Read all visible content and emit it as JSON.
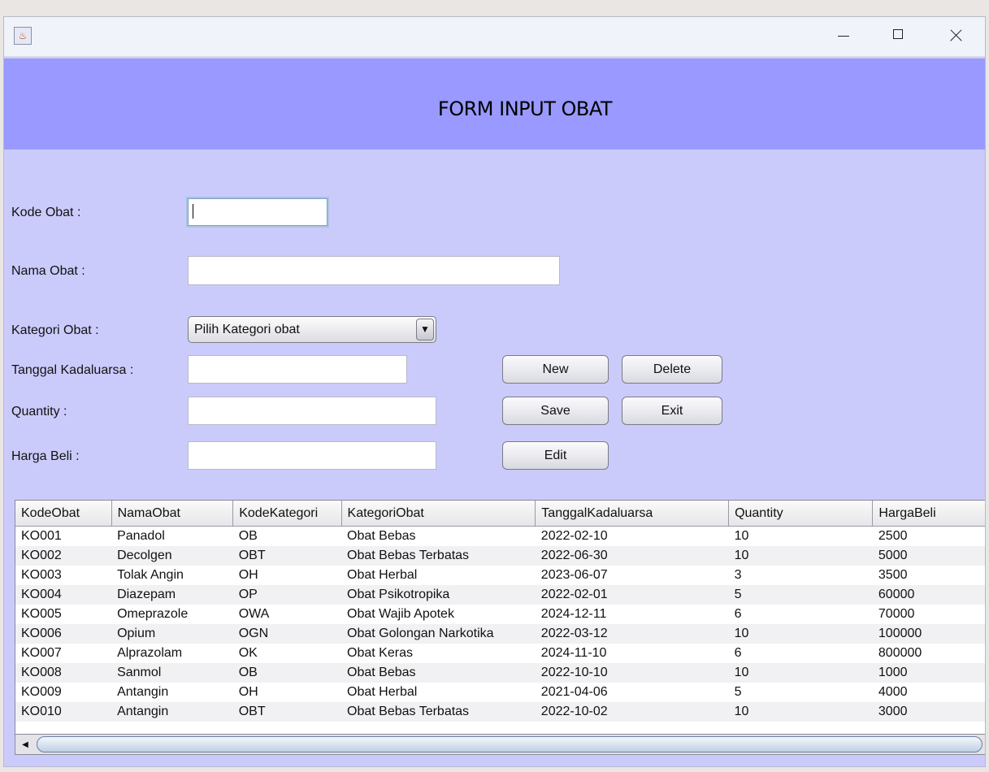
{
  "header": {
    "title": "FORM INPUT OBAT"
  },
  "icons": {
    "app": "java-cup-icon",
    "minimize": "minimize-icon",
    "maximize": "maximize-icon",
    "close": "close-icon",
    "combo_arrow": "chevron-down-icon",
    "scroll_left": "scroll-left-icon"
  },
  "form": {
    "kode_label": "Kode Obat :",
    "kode_value": "",
    "nama_label": "Nama Obat :",
    "nama_value": "",
    "kategori_label": "Kategori Obat :",
    "kategori_selected": "Pilih Kategori obat",
    "tanggal_label": "Tanggal Kadaluarsa :",
    "tanggal_value": "",
    "quantity_label": "Quantity :",
    "quantity_value": "",
    "harga_label": "Harga Beli :",
    "harga_value": ""
  },
  "buttons": {
    "new": "New",
    "delete": "Delete",
    "save": "Save",
    "exit": "Exit",
    "edit": "Edit"
  },
  "table": {
    "columns": [
      "KodeObat",
      "NamaObat",
      "KodeKategori",
      "KategoriObat",
      "TanggalKadaluarsa",
      "Quantity",
      "HargaBeli"
    ],
    "rows": [
      [
        "KO001",
        "Panadol",
        "OB",
        "Obat Bebas",
        "2022-02-10",
        "10",
        "2500"
      ],
      [
        "KO002",
        "Decolgen",
        "OBT",
        "Obat Bebas Terbatas",
        "2022-06-30",
        "10",
        "5000"
      ],
      [
        "KO003",
        "Tolak Angin",
        "OH",
        "Obat Herbal",
        "2023-06-07",
        "3",
        "3500"
      ],
      [
        "KO004",
        "Diazepam",
        "OP",
        "Obat Psikotropika",
        "2022-02-01",
        "5",
        "60000"
      ],
      [
        "KO005",
        "Omeprazole",
        "OWA",
        "Obat Wajib Apotek",
        "2024-12-11",
        "6",
        "70000"
      ],
      [
        "KO006",
        "Opium",
        "OGN",
        "Obat Golongan Narkotika",
        "2022-03-12",
        "10",
        "100000"
      ],
      [
        "KO007",
        "Alprazolam",
        "OK",
        "Obat Keras",
        "2024-11-10",
        "6",
        "800000"
      ],
      [
        "KO008",
        "Sanmol",
        "OB",
        "Obat Bebas",
        "2022-10-10",
        "10",
        "1000"
      ],
      [
        "KO009",
        "Antangin",
        "OH",
        "Obat Herbal",
        "2021-04-06",
        "5",
        "4000"
      ],
      [
        "KO010",
        "Antangin",
        "OBT",
        "Obat Bebas Terbatas",
        "2022-10-02",
        "10",
        "3000"
      ]
    ]
  }
}
